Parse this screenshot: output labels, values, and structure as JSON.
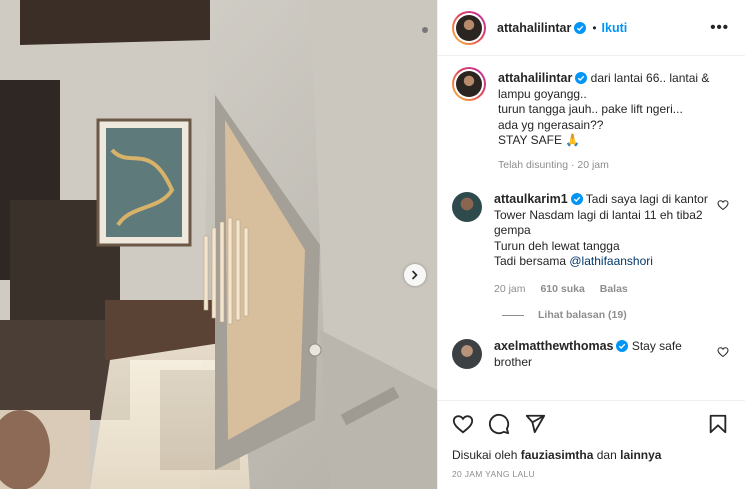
{
  "post": {
    "author": "attahalilintar",
    "follow_label": "Ikuti",
    "more_label": "•••",
    "caption": {
      "author": "attahalilintar",
      "text": "dari lantai 66.. lantai & lampu goyangg..\nturun tangga jauh.. pake lift ngeri...\nada yg ngerasain??\nSTAY SAFE 🙏",
      "edited": "Telah disunting · 20 jam"
    }
  },
  "comments": [
    {
      "author": "attaulkarim1",
      "text": "Tadi saya lagi di kantor Tower Nasdam lagi di lantai 11 eh tiba2 gempa\nTurun deh lewat tangga\nTadi bersama ",
      "mention": "@lathifaanshori",
      "time": "20 jam",
      "likes": "610 suka",
      "reply": "Balas",
      "view_replies": "Lihat balasan (19)"
    },
    {
      "author": "axelmatthewthomas",
      "text": "Stay safe brother"
    }
  ],
  "footer": {
    "liked_by_prefix": "Disukai oleh",
    "liked_by_user": "fauziasimtha",
    "liked_by_joiner": "dan",
    "liked_by_others": "lainnya",
    "timestamp": "20 JAM YANG LALU"
  },
  "colors": {
    "accent": "#0095f6",
    "verified": "#0095f6",
    "meta": "#8e8e8e"
  },
  "icons": [
    "verified-badge-icon",
    "heart-icon",
    "comment-icon",
    "share-icon",
    "bookmark-icon",
    "chevron-right-icon"
  ]
}
